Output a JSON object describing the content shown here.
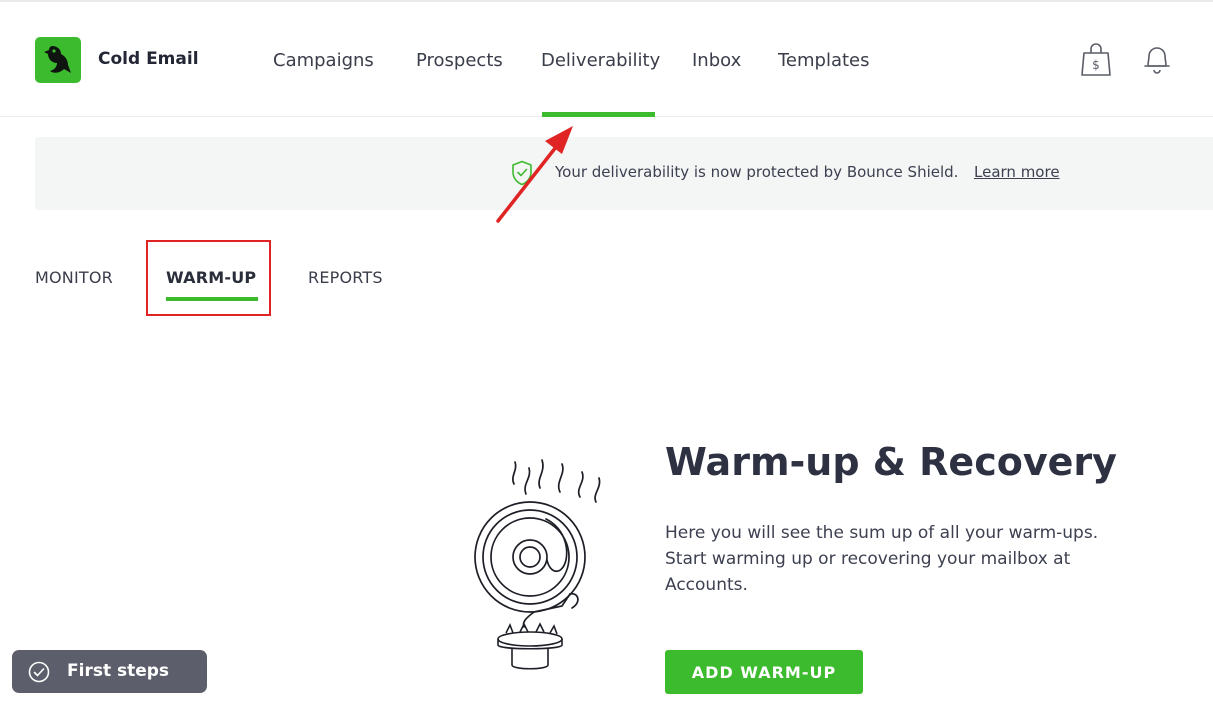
{
  "app": {
    "brand_name": "Cold Email"
  },
  "nav": {
    "items": [
      {
        "label": "Campaigns"
      },
      {
        "label": "Prospects"
      },
      {
        "label": "Deliverability",
        "active": true
      },
      {
        "label": "Inbox"
      },
      {
        "label": "Templates"
      }
    ]
  },
  "header_icons": [
    "shopping-bag-dollar-icon",
    "notification-bell-icon"
  ],
  "banner": {
    "text": "Your deliverability is now protected by Bounce Shield.",
    "link": "Learn more",
    "icon": "shield-check-icon"
  },
  "subtabs": [
    {
      "label": "MONITOR"
    },
    {
      "label": "WARM-UP",
      "active": true
    },
    {
      "label": "REPORTS"
    }
  ],
  "hero": {
    "title": "Warm-up & Recovery",
    "description": "Here you will see the sum up of all your warm-ups. Start warming up or recovering your mailbox at Accounts.",
    "button": "ADD WARM-UP"
  },
  "first_steps": {
    "label": "First steps"
  },
  "colors": {
    "accent": "#3dbb2f",
    "annotation": "#e02424",
    "text": "#2d3142"
  }
}
